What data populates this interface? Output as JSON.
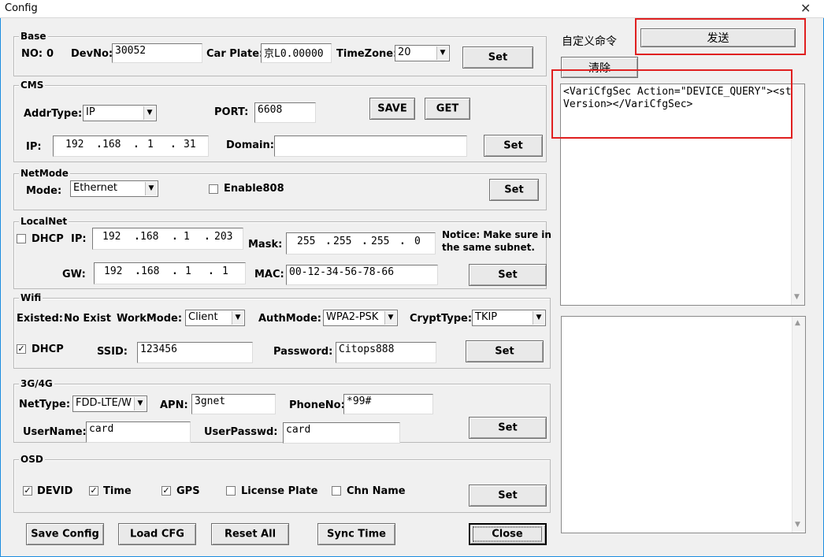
{
  "window": {
    "title": "Config",
    "close_glyph": "✕"
  },
  "base": {
    "group": "Base",
    "no_label": "NO:",
    "no_value": "0",
    "devno_label": "DevNo:",
    "devno_value": "30052",
    "carplate_label": "Car Plate:",
    "carplate_value": "京L0.00000",
    "timezone_label": "TimeZone:",
    "timezone_value": "20",
    "set": "Set"
  },
  "cms": {
    "group": "CMS",
    "addrtype_label": "AddrType:",
    "addrtype_value": "IP",
    "port_label": "PORT:",
    "port_value": "6608",
    "save": "SAVE",
    "get": "GET",
    "ip_label": "IP:",
    "ip": [
      "192",
      "168",
      "1",
      "31"
    ],
    "domain_label": "Domain:",
    "domain_value": "",
    "set": "Set"
  },
  "netmode": {
    "group": "NetMode",
    "mode_label": "Mode:",
    "mode_value": "Ethernet",
    "enable808": "Enable808",
    "set": "Set"
  },
  "localnet": {
    "group": "LocalNet",
    "dhcp": "DHCP",
    "ip_label": "IP:",
    "ip": [
      "192",
      "168",
      "1",
      "203"
    ],
    "mask_label": "Mask:",
    "mask": [
      "255",
      "255",
      "255",
      "0"
    ],
    "notice": [
      "Notice: Make sure in",
      "the same subnet."
    ],
    "gw_label": "GW:",
    "gw": [
      "192",
      "168",
      "1",
      "1"
    ],
    "mac_label": "MAC:",
    "mac_value": "00-12-34-56-78-66",
    "set": "Set"
  },
  "wifi": {
    "group": "Wifi",
    "existed_label": "Existed:",
    "existed_value": "No Exist",
    "workmode_label": "WorkMode:",
    "workmode_value": "Client",
    "authmode_label": "AuthMode:",
    "authmode_value": "WPA2-PSK",
    "crypttype_label": "CryptType:",
    "crypttype_value": "TKIP",
    "dhcp": "DHCP",
    "ssid_label": "SSID:",
    "ssid_value": "123456",
    "password_label": "Password:",
    "password_value": "Citops888",
    "set": "Set"
  },
  "g34": {
    "group": "3G/4G",
    "nettype_label": "NetType:",
    "nettype_value": "FDD-LTE/W",
    "apn_label": "APN:",
    "apn_value": "3gnet",
    "phoneno_label": "PhoneNo:",
    "phoneno_value": "*99#",
    "username_label": "UserName:",
    "username_value": "card",
    "userpasswd_label": "UserPasswd:",
    "userpasswd_value": "card",
    "set": "Set"
  },
  "osd": {
    "group": "OSD",
    "devid": "DEVID",
    "time": "Time",
    "gps": "GPS",
    "license": "License Plate",
    "chn": "Chn Name",
    "set": "Set"
  },
  "footer": {
    "save_config": "Save Config",
    "load_cfg": "Load CFG",
    "reset_all": "Reset All",
    "sync_time": "Sync Time",
    "close": "Close"
  },
  "custom": {
    "label": "自定义命令",
    "send": "发送",
    "clear": "清除",
    "command": "<VariCfgSec Action=\"DEVICE_QUERY\"><stVersion></VariCfgSec>"
  },
  "colors": {
    "highlight": "#e02020",
    "title_border": "#1c8de0"
  },
  "icons": {
    "dropdown": "chevron-down-icon",
    "check": "check-icon"
  }
}
